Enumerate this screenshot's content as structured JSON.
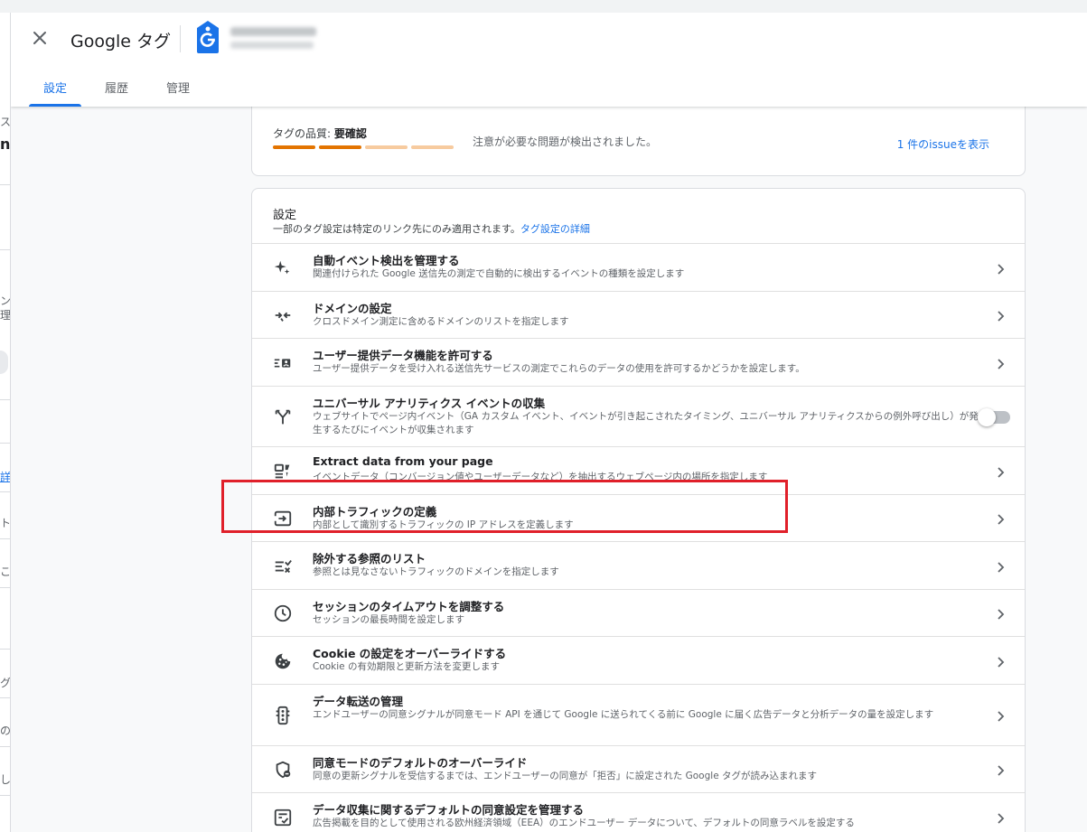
{
  "header": {
    "close_label": "×",
    "app_title": "Google タグ"
  },
  "tabs": [
    {
      "label": "設定",
      "active": true
    },
    {
      "label": "履歴",
      "active": false
    },
    {
      "label": "管理",
      "active": false
    }
  ],
  "background_fragments": [
    "ス",
    "nt",
    "ン",
    "理",
    "詳細",
    "ト",
    "こ",
    "グ",
    "の",
    "し"
  ],
  "quality": {
    "label_prefix": "タグの品質: ",
    "status": "要確認",
    "bar_levels": [
      1,
      1,
      0,
      0
    ],
    "bar_color_full": "#e37400",
    "bar_color_empty": "#f7cb9f",
    "message": "注意が必要な問題が検出されました。",
    "issues_link": "1 件のissueを表示"
  },
  "settings": {
    "title": "設定",
    "description": "一部のタグ設定は特定のリンク先にのみ適用されます。",
    "details_link": "タグ設定の詳細",
    "rows": [
      {
        "icon": "sparkle-icon",
        "title": "自動イベント検出を管理する",
        "subtitle": "関連付けられた Google 送信先の測定で自動的に検出するイベントの種類を設定します",
        "control": "chevron"
      },
      {
        "icon": "merge-arrows-icon",
        "title": "ドメインの設定",
        "subtitle": "クロスドメイン測定に含めるドメインのリストを指定します",
        "control": "chevron"
      },
      {
        "icon": "user-data-icon",
        "title": "ユーザー提供データ機能を許可する",
        "subtitle": "ユーザー提供データを受け入れる送信先サービスの測定でこれらのデータの使用を許可するかどうかを設定します。",
        "control": "chevron"
      },
      {
        "icon": "fork-icon",
        "title": "ユニバーサル アナリティクス イベントの収集",
        "subtitle": "ウェブサイトでページ内イベント（GA カスタム イベント、イベントが引き起こされたタイミング、ユニバーサル アナリティクスからの例外呼び出し）が発生するたびにイベントが収集されます",
        "control": "toggle",
        "toggle_on": false
      },
      {
        "icon": "extract-data-icon",
        "title": "Extract data from your page",
        "subtitle": "イベントデータ（コンバージョン値やユーザーデータなど）を抽出するウェブページ内の場所を指定します",
        "control": "chevron"
      },
      {
        "icon": "login-arrow-icon",
        "title": "内部トラフィックの定義",
        "subtitle": "内部として識別するトラフィックの IP アドレスを定義します",
        "control": "chevron"
      },
      {
        "icon": "exclude-list-icon",
        "title": "除外する参照のリスト",
        "subtitle": "参照とは見なさないトラフィックのドメインを指定します",
        "control": "chevron"
      },
      {
        "icon": "clock-icon",
        "title": "セッションのタイムアウトを調整する",
        "subtitle": "セッションの最長時間を設定します",
        "control": "chevron"
      },
      {
        "icon": "cookie-icon",
        "title": "Cookie の設定をオーバーライドする",
        "subtitle": "Cookie の有効期限と更新方法を変更します",
        "control": "chevron"
      },
      {
        "icon": "traffic-light-icon",
        "title": "データ転送の管理",
        "subtitle": "エンドユーザーの同意シグナルが同意モード API を通じて Google に送られてくる前に Google に届く広告データと分析データの量を設定します",
        "control": "chevron"
      },
      {
        "icon": "shield-minus-icon",
        "title": "同意モードのデフォルトのオーバーライド",
        "subtitle": "同意の更新シグナルを受信するまでは、エンドユーザーの同意が「拒否」に設定された Google タグが読み込まれます",
        "control": "chevron"
      },
      {
        "icon": "checklist-icon",
        "title": "データ収集に関するデフォルトの同意設定を管理する",
        "subtitle": "広告掲載を目的として使用される欧州経済領域（EEA）のエンドユーザー データについて、デフォルトの同意ラベルを設定する",
        "control": "chevron"
      }
    ]
  },
  "colors": {
    "accent": "#1a73e8",
    "highlight_box": "#e0202a"
  }
}
